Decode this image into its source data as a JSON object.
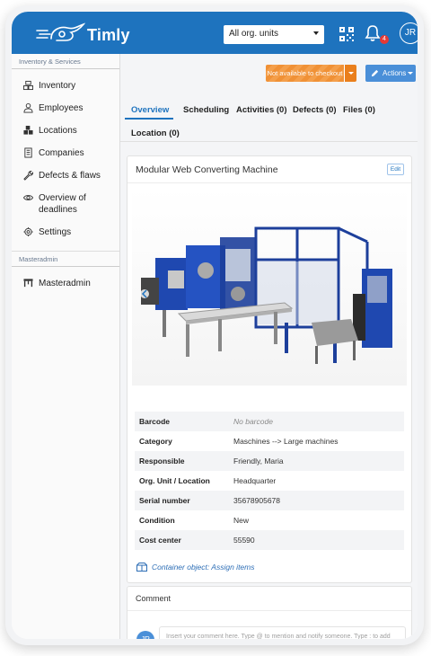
{
  "app": {
    "logo_text": "Timly"
  },
  "topbar": {
    "org_select_value": "All org. units",
    "notification_count": "4",
    "user_initials": "JR"
  },
  "sidebar": {
    "section_inventory": "Inventory & Services",
    "items": [
      {
        "label": "Inventory",
        "icon": "boxes-icon"
      },
      {
        "label": "Employees",
        "icon": "person-icon"
      },
      {
        "label": "Locations",
        "icon": "cubes-icon"
      },
      {
        "label": "Companies",
        "icon": "building-icon"
      },
      {
        "label": "Defects & flaws",
        "icon": "wrench-icon"
      },
      {
        "label": "Overview of\ndeadlines",
        "icon": "eye-icon"
      },
      {
        "label": "Settings",
        "icon": "gear-icon"
      }
    ],
    "section_master": "Masteradmin",
    "master_items": [
      {
        "label": "Masteradmin",
        "icon": "table-icon"
      }
    ]
  },
  "actions": {
    "checkout_label": "Not available to checkout",
    "actions_label": "Actions"
  },
  "tabs": [
    {
      "label": "Overview",
      "active": true
    },
    {
      "label": "Scheduling"
    },
    {
      "label": "Activities (0)"
    },
    {
      "label": "Defects (0)"
    },
    {
      "label": "Files (0)"
    },
    {
      "label": "Location (0)"
    }
  ],
  "item": {
    "title": "Modular Web Converting Machine",
    "edit_label": "Edit",
    "properties": [
      {
        "key": "Barcode",
        "value": "No barcode",
        "muted": true
      },
      {
        "key": "Category",
        "value": "Maschines --> Large machines"
      },
      {
        "key": "Responsible",
        "value": "Friendly, Maria"
      },
      {
        "key": "Org. Unit / Location",
        "value": "Headquarter"
      },
      {
        "key": "Serial number",
        "value": "35678905678"
      },
      {
        "key": "Condition",
        "value": "New"
      },
      {
        "key": "Cost center",
        "value": "55590"
      }
    ],
    "container_link": "Container object: Assign items"
  },
  "comment": {
    "title": "Comment",
    "avatar_initials": "JR",
    "placeholder": "Insert your comment here. Type @ to mention and notify someone. Type : to add an emoji."
  },
  "colors": {
    "brand_blue": "#1e73be",
    "orange": "#f08c2c",
    "badge_red": "#e53935"
  }
}
